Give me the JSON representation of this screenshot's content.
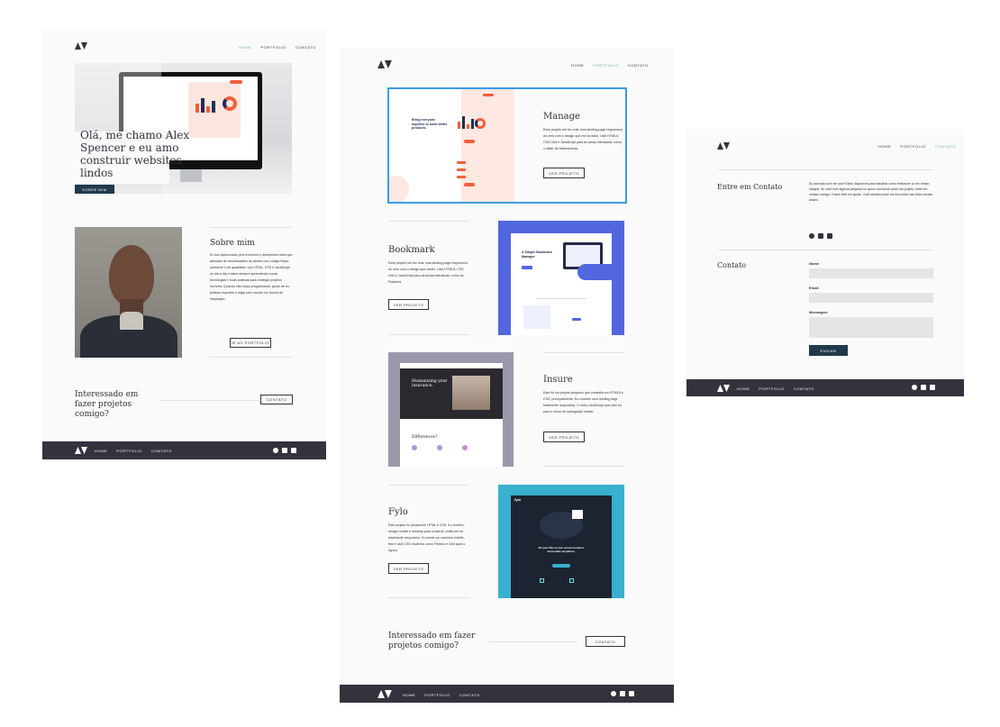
{
  "logo": {
    "name": "logo"
  },
  "nav": {
    "home": "Home",
    "portfolio": "Portfolio",
    "contact": "Contato"
  },
  "home": {
    "hero_title": "Olá, me chamo Alex Spencer e eu amo construir websites lindos",
    "hero_button": "Sobre mim",
    "about_title": "Sobre mim",
    "about_text": "Eu sou apaixonado pelo front-end e desenvolvo sites que atendam às necessidades do cliente com código limpo, acessível e de qualidade. Uso HTML, CSS e JavaScript no dia a dia e estou sempre aprendendo novas tecnologias e boas práticas para entregar projetos incríveis. Quando não estou programando, gosto de ler, praticar esportes e viajar pelo mundo em busca de inspiração.",
    "about_button": "Ir ao Portfólio",
    "cta_title": "Interessado em fazer projetos comigo?",
    "cta_button": "Contato"
  },
  "portfolio": {
    "projects": [
      {
        "title": "Manage",
        "text": "Esse projeto me fez criar uma landing page responsiva do zero com o design que me foi dado. Usei HTML5, CSS Grid e JavaScript para as áreas interativas, como o slider de testemunhas.",
        "button": "Ver Projeto",
        "accent": "#f25f3a"
      },
      {
        "title": "Bookmark",
        "text": "Esse projeto me fez criar uma landing page responsiva do zero com o design que recebi. Usei HTML5, CSS Grid e JavaScript para as áreas interativas, como as Features.",
        "button": "Ver Projeto",
        "accent": "#5267df"
      },
      {
        "title": "Insure",
        "text": "Este foi um projeto pequeno que consistia em HTML5 e CSS, principalmente. Eu construí uma landing page totalmente responsiva. O único JavaScript que usei foi para o menu de navegação mobile.",
        "button": "Ver Projeto",
        "accent": "#2c2830"
      },
      {
        "title": "Fylo",
        "text": "Este projeto foi puramente HTML e CSS. Eu recebi o design mobile e desktop para construir, então ele foi totalmente responsivo. Eu tomei um caminho mobile-first e usei CSS moderno como Flexbox e Grid para o layout.",
        "button": "Ver Projeto",
        "accent": "#1c2431"
      }
    ],
    "manage_mock": {
      "headline": "Bring everyone together to build better products."
    },
    "bookmark_mock": {
      "headline": "A Simple Bookmark Manager"
    },
    "insure_mock": {
      "headline": "Humanizing your insurance.",
      "sub": "Differences?"
    },
    "fylo_mock": {
      "brand": "fylo",
      "headline": "All your files in one secure location, accessible anywhere."
    },
    "cta_title": "Interessado em fazer projetos comigo?",
    "cta_button": "Contato"
  },
  "contact": {
    "title": "Entre em Contato",
    "text": "Eu adoraria ouvir de você! Estou disponível para trabalhar como freelancer ou em tempo integral. Se você tiver alguma pergunta ou quiser conversar sobre um projeto, entre em contato comigo. Ficarei feliz em ajudar. Você também pode me encontrar nas redes sociais abaixo.",
    "form_title": "Contato",
    "label_name": "Nome",
    "label_email": "Email",
    "label_message": "Mensagem",
    "button": "Enviar"
  },
  "colors": {
    "dark": "#33323d",
    "accent": "#5fb4a2",
    "navy": "#203a4c",
    "page": "#fafafa",
    "input": "#e5e5e7"
  }
}
